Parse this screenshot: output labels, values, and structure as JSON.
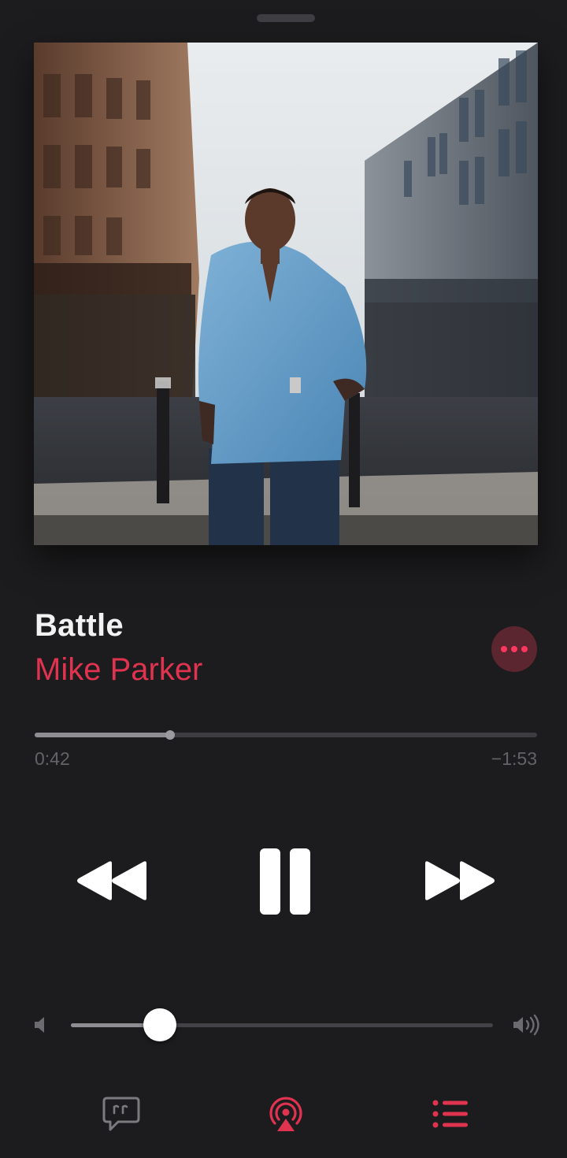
{
  "grabber": {
    "icon": "grabber-handle"
  },
  "now_playing": {
    "song_title": "Battle",
    "artist": "Mike Parker",
    "artwork_icon": "album-artwork-photo"
  },
  "more_button": {
    "icon": "ellipsis-icon"
  },
  "progress": {
    "elapsed": "0:42",
    "remaining": "−1:53",
    "fraction": 0.27
  },
  "transport": {
    "rewind_icon": "rewind-icon",
    "pause_icon": "pause-icon",
    "forward_icon": "fast-forward-icon"
  },
  "volume": {
    "fraction": 0.21,
    "low_icon": "speaker-low-icon",
    "high_icon": "speaker-high-icon"
  },
  "bottom_bar": {
    "lyrics_icon": "lyrics-icon",
    "airplay_icon": "airplay-audio-icon",
    "queue_icon": "queue-list-icon"
  },
  "colors": {
    "background": "#1c1c1e",
    "accent": "#e0334f",
    "text": "#f2f2f2",
    "secondary": "#636367"
  }
}
